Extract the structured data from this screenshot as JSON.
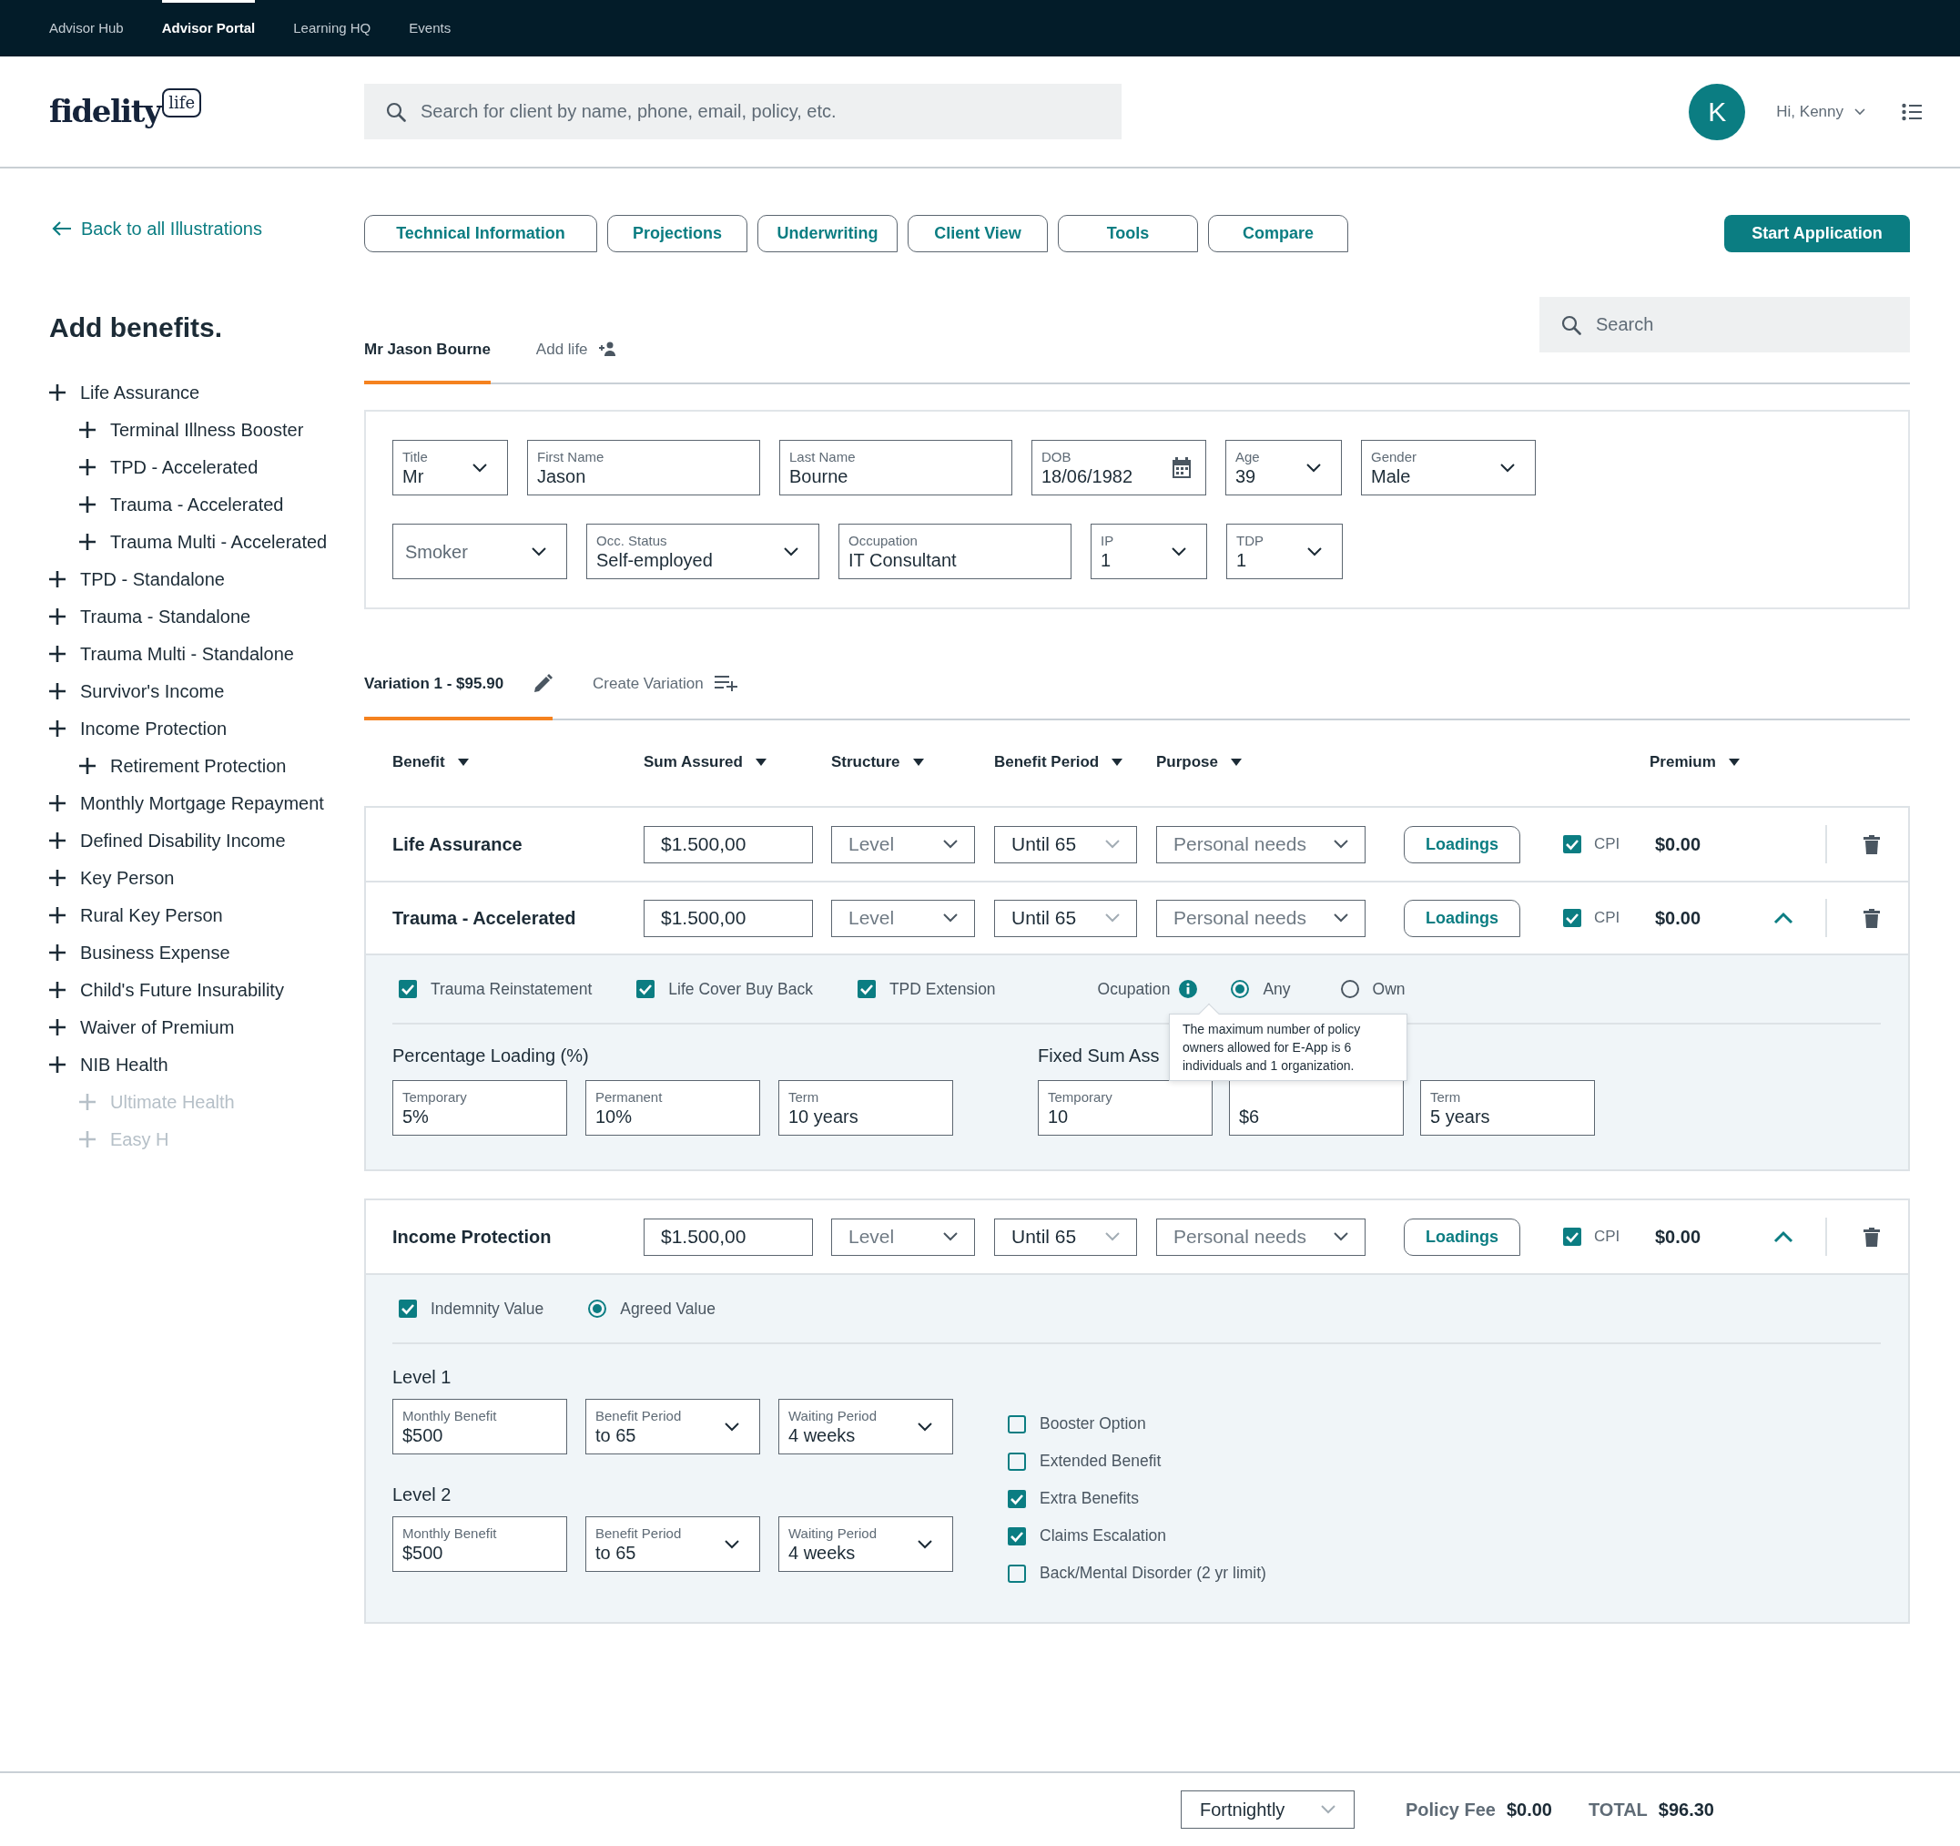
{
  "top_nav": [
    {
      "label": "Advisor Hub",
      "selected": false
    },
    {
      "label": "Advisor Portal",
      "selected": true
    },
    {
      "label": "Learning HQ",
      "selected": false
    },
    {
      "label": "Events",
      "selected": false
    }
  ],
  "logo": {
    "text": "fidelity",
    "badge": "life"
  },
  "client_search": {
    "placeholder": "Search for client by name, phone, email, policy, etc."
  },
  "user": {
    "initial": "K",
    "greeting": "Hi, Kenny"
  },
  "back_link": "Back to all Illustrations",
  "tool_buttons": [
    "Technical Information",
    "Projections",
    "Underwriting",
    "Client View",
    "Tools",
    "Compare"
  ],
  "start_button": "Start Application",
  "sidebar": {
    "title": "Add benefits.",
    "items": [
      {
        "label": "Life Assurance",
        "disabled": false,
        "children": [
          {
            "label": "Terminal Illness Booster",
            "disabled": false
          },
          {
            "label": "TPD - Accelerated",
            "disabled": false
          },
          {
            "label": "Trauma - Accelerated",
            "disabled": false
          },
          {
            "label": "Trauma Multi - Accelerated",
            "disabled": false
          }
        ]
      },
      {
        "label": "TPD - Standalone",
        "disabled": false
      },
      {
        "label": "Trauma - Standalone",
        "disabled": false
      },
      {
        "label": "Trauma Multi - Standalone",
        "disabled": false
      },
      {
        "label": "Survivor's Income",
        "disabled": false
      },
      {
        "label": "Income Protection",
        "disabled": false,
        "children": [
          {
            "label": "Retirement Protection",
            "disabled": false
          }
        ]
      },
      {
        "label": "Monthly Mortgage Repayment",
        "disabled": false
      },
      {
        "label": "Defined Disability Income",
        "disabled": false
      },
      {
        "label": "Key Person",
        "disabled": false
      },
      {
        "label": "Rural Key Person",
        "disabled": false
      },
      {
        "label": "Business Expense",
        "disabled": false
      },
      {
        "label": "Child's Future Insurability",
        "disabled": false
      },
      {
        "label": "Waiver of Premium",
        "disabled": false
      },
      {
        "label": "NIB Health",
        "disabled": false,
        "children": [
          {
            "label": "Ultimate Health",
            "disabled": true
          },
          {
            "label": "Easy H",
            "disabled": true
          }
        ]
      }
    ]
  },
  "search": {
    "placeholder": "Search"
  },
  "life_tabs": [
    {
      "label": "Mr Jason Bourne",
      "selected": true,
      "kind": "life"
    },
    {
      "label": "Add life",
      "selected": false,
      "kind": "add"
    }
  ],
  "person_fields": [
    [
      {
        "kind": "select",
        "label": "Title",
        "value": "Mr"
      },
      {
        "label": "First Name",
        "value": "Jason"
      },
      {
        "label": "Last Name",
        "value": "Bourne"
      },
      {
        "kind": "date",
        "label": "DOB",
        "value": "18/06/1982"
      },
      {
        "kind": "select",
        "label": "Age",
        "value": "39"
      },
      {
        "kind": "select",
        "label": "Gender",
        "value": "Male"
      }
    ],
    [
      {
        "kind": "select",
        "placeholder": "Smoker"
      },
      {
        "kind": "select",
        "label": "Occ. Status",
        "value": "Self-employed"
      },
      {
        "label": "Occupation",
        "value": "IT Consultant"
      },
      {
        "kind": "select",
        "label": "IP",
        "value": "1"
      },
      {
        "kind": "select",
        "label": "TDP",
        "value": "1"
      }
    ]
  ],
  "variation_tabs": [
    {
      "label": "Variation 1 - $95.90",
      "selected": true,
      "kind": "edit"
    },
    {
      "label": "Create Variation",
      "selected": false,
      "kind": "add"
    }
  ],
  "columns": [
    "Benefit",
    "Sum Assured",
    "Structure",
    "Benefit Period",
    "Purpose",
    "Premium"
  ],
  "benefit_groups": [
    {
      "benefits": [
        {
          "name": "Life Assurance",
          "sum_assured": "$1.500,00",
          "structure": "Level",
          "benefit_period": "Until 65",
          "purpose": "Personal needs",
          "loadings": "Loadings",
          "cpi_label": "CPI",
          "cpi": true,
          "premium": "$0.00",
          "expanded": false
        },
        {
          "name": "Trauma - Accelerated",
          "sum_assured": "$1.500,00",
          "structure": "Level",
          "benefit_period": "Until 65",
          "purpose": "Personal needs",
          "loadings": "Loadings",
          "cpi_label": "CPI",
          "cpi": true,
          "premium": "$0.00",
          "expanded": true,
          "details": {
            "kind": "trauma",
            "options": [
              {
                "kind": "checkbox",
                "label": "Trauma Reinstatement",
                "checked": true
              },
              {
                "kind": "checkbox",
                "label": "Life Cover Buy Back",
                "checked": true
              },
              {
                "kind": "checkbox",
                "label": "TPD Extension",
                "checked": true
              }
            ],
            "occupation": {
              "label": "Ocupation",
              "choices": [
                {
                  "label": "Any",
                  "selected": true
                },
                {
                  "label": "Own",
                  "selected": false
                }
              ]
            },
            "sections": [
              {
                "title": "Percentage Loading (%)",
                "fields": [
                  {
                    "label": "Temporary",
                    "value": "5%"
                  },
                  {
                    "label": "Permanent",
                    "value": "10%"
                  },
                  {
                    "label": "Term",
                    "value": "10 years"
                  }
                ]
              },
              {
                "title": "Fixed Sum Ass",
                "fields": [
                  {
                    "label": "Temporary",
                    "value": "10"
                  },
                  {
                    "value": "$6"
                  },
                  {
                    "label": "Term",
                    "value": "5 years"
                  }
                ]
              }
            ],
            "tooltip": "The maximum number of policy owners allowed for E-App is 6 individuals and 1 organization."
          }
        }
      ]
    },
    {
      "benefits": [
        {
          "name": "Income Protection",
          "sum_assured": "$1.500,00",
          "structure": "Level",
          "benefit_period": "Until 65",
          "purpose": "Personal needs",
          "loadings": "Loadings",
          "cpi_label": "CPI",
          "cpi": true,
          "premium": "$0.00",
          "expanded": true,
          "details": {
            "kind": "income",
            "options": [
              {
                "kind": "checkbox",
                "label": "Indemnity Value",
                "checked": true
              },
              {
                "kind": "radio",
                "label": "Agreed Value",
                "selected": true
              }
            ],
            "levels": [
              {
                "title": "Level 1",
                "fields": [
                  {
                    "label": "Monthly Benefit",
                    "value": "$500"
                  },
                  {
                    "kind": "select",
                    "label": "Benefit Period",
                    "value": "to 65"
                  },
                  {
                    "kind": "select",
                    "label": "Waiting Period",
                    "value": "4 weeks"
                  }
                ]
              },
              {
                "title": "Level 2",
                "fields": [
                  {
                    "label": "Monthly Benefit",
                    "value": "$500"
                  },
                  {
                    "kind": "select",
                    "label": "Benefit Period",
                    "value": "to 65"
                  },
                  {
                    "kind": "select",
                    "label": "Waiting Period",
                    "value": "4 weeks"
                  }
                ]
              }
            ],
            "extras": [
              {
                "label": "Booster Option",
                "checked": false
              },
              {
                "label": "Extended Benefit",
                "checked": false
              },
              {
                "label": "Extra Benefits",
                "checked": true
              },
              {
                "label": "Claims Escalation",
                "checked": true
              },
              {
                "label": "Back/Mental Disorder (2 yr limit)",
                "checked": false
              }
            ]
          }
        }
      ]
    }
  ],
  "footer": {
    "frequency": "Fortnightly",
    "policy_fee_label": "Policy Fee",
    "policy_fee": "$0.00",
    "total_label": "TOTAL",
    "total": "$96.30"
  }
}
